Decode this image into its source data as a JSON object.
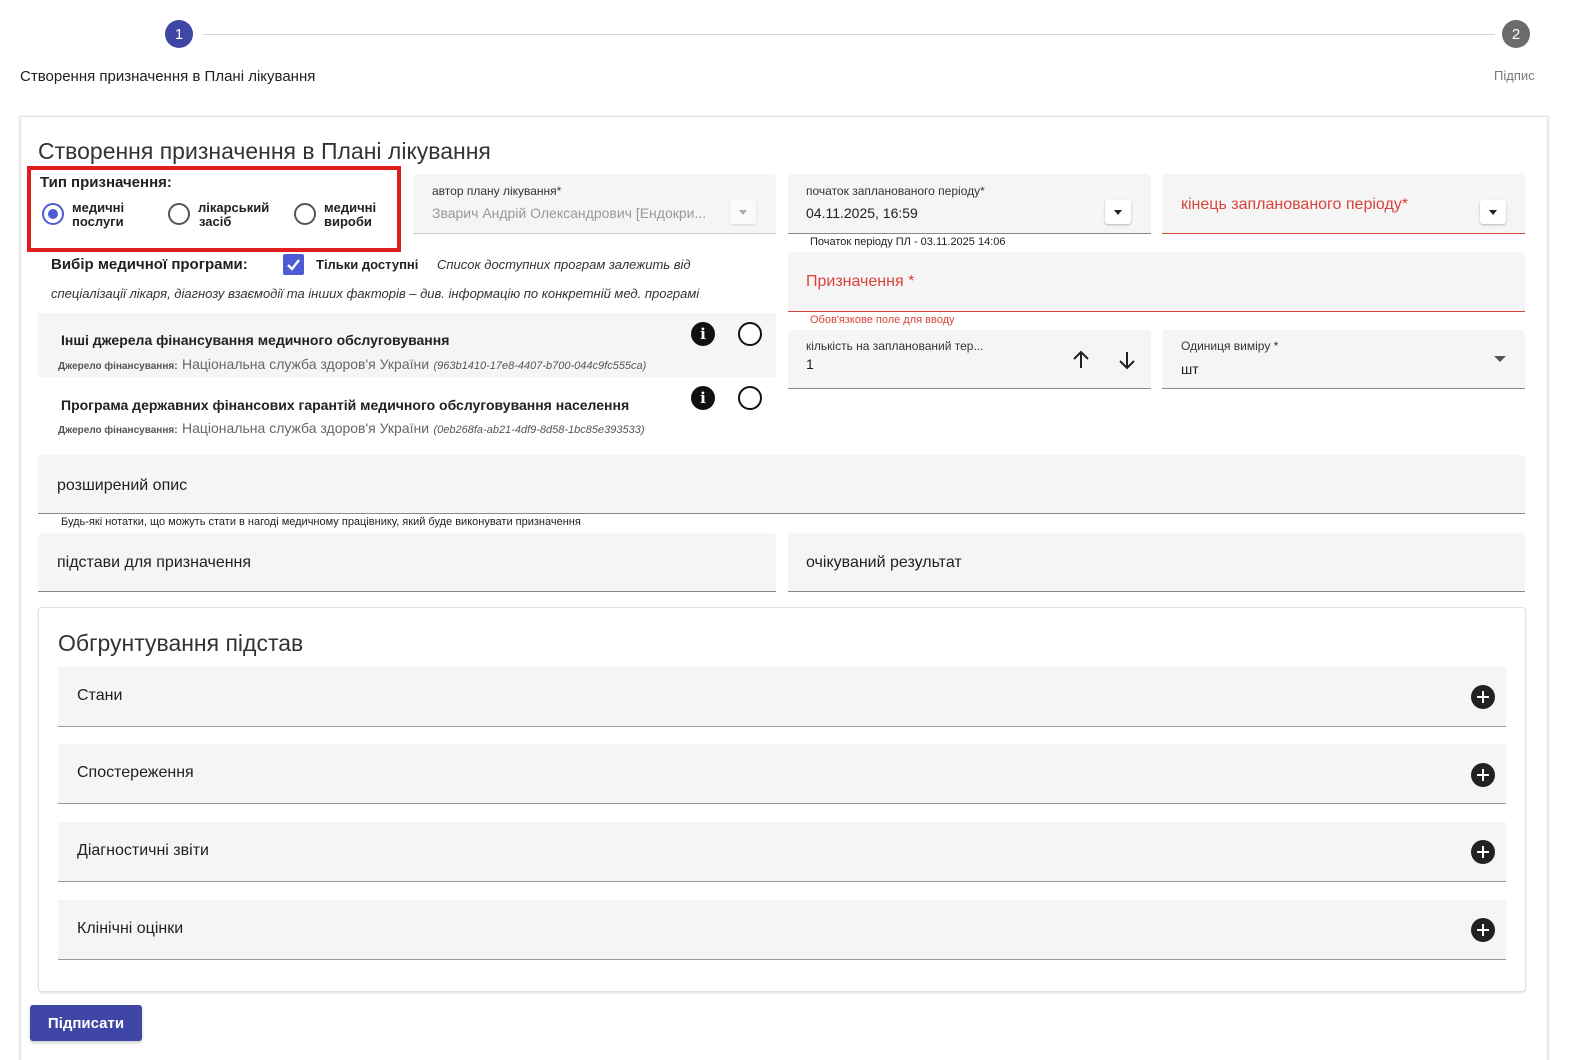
{
  "stepper": {
    "step1_number": "1",
    "step1_label": "Створення призначення в Плані лікування",
    "step2_number": "2",
    "step2_label": "Підпис"
  },
  "form": {
    "title": "Створення призначення в Плані лікування",
    "type": {
      "label": "Тип призначення:",
      "options": [
        {
          "line1": "медичні",
          "line2": "послуги",
          "selected": true
        },
        {
          "line1": "лікарський",
          "line2": "засіб",
          "selected": false
        },
        {
          "line1": "медичні",
          "line2": "вироби",
          "selected": false
        }
      ]
    },
    "author": {
      "label": "автор плану лікування*",
      "value": "Зварич Андрій Олександрович [Ендокри..."
    },
    "period_start": {
      "label": "початок запланованого періоду*",
      "value": "04.11.2025, 16:59",
      "helper": "Початок періоду ПЛ - 03.11.2025 14:06"
    },
    "period_end": {
      "label": "кінець запланованого періоду*"
    },
    "program": {
      "label": "Вибір медичної програми:",
      "only_available_label": "Тільки доступні",
      "only_available_checked": true,
      "note_line1": "Список доступних програм залежить від",
      "note_line2": "спеціалізації лікаря, діагнозу взаємодії та інших факторів – див. інформацію по конкретній мед. програмі",
      "items": [
        {
          "title": "Інші джерела фінансування медичного обслуговування",
          "source_label": "Джерело фінансування:",
          "source_name": "Національна служба здоров'я України",
          "source_id": "(963b1410-17e8-4407-b700-044c9fc555ca)"
        },
        {
          "title": "Програма державних фінансових гарантій медичного обслуговування населення",
          "source_label": "Джерело фінансування:",
          "source_name": "Національна служба здоров'я України",
          "source_id": "(0eb268fa-ab21-4df9-8d58-1bc85e393533)"
        }
      ]
    },
    "assignment": {
      "label": "Призначення *",
      "error": "Обов'язкове поле для вводу"
    },
    "quantity": {
      "label": "кількість на запланований тер...",
      "value": "1"
    },
    "unit": {
      "label": "Одиниця виміру *",
      "value": "шт"
    },
    "extended_desc": {
      "label": "розширений опис",
      "helper": "Будь-які нотатки, що можуть стати в нагоді медичному працівнику, який буде виконувати призначення"
    },
    "grounds": {
      "label": "підстави для призначення"
    },
    "expected": {
      "label": "очікуваний результат"
    },
    "justification": {
      "title": "Обгрунтування підстав",
      "sections": [
        "Стани",
        "Спостереження",
        "Діагностичні звіти",
        "Клінічні оцінки"
      ]
    },
    "sign_button": "Підписати"
  },
  "colors": {
    "primary": "#3f46a6",
    "step_inactive": "#6b6b6b",
    "error": "#d9443a",
    "highlight_border": "#e01e1e",
    "checkbox": "#4f5bd5"
  }
}
